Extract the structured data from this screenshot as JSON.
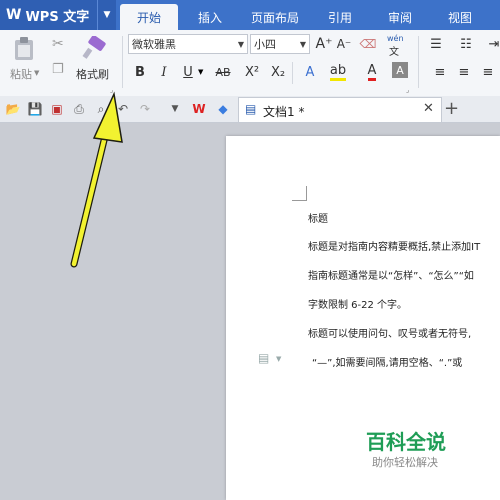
{
  "app": {
    "name": "WPS 文字"
  },
  "menu_tabs": [
    {
      "label": "开始",
      "active": true
    },
    {
      "label": "插入"
    },
    {
      "label": "页面布局"
    },
    {
      "label": "引用"
    },
    {
      "label": "审阅"
    },
    {
      "label": "视图"
    }
  ],
  "ribbon": {
    "paste_label": "粘贴",
    "format_painter_label": "格式刷",
    "font_name": "微软雅黑",
    "font_size": "小四",
    "pinyin_label": "wén"
  },
  "document": {
    "tab_title": "文档1 *",
    "lines": [
      "标题",
      "标题是对指南内容精要概括,禁止添加IT",
      "指南标题通常是以“怎样”、“怎么”“如",
      "字数限制 6-22 个字。",
      "标题可以使用问句、叹号或者无符号,",
      "“—”,如需要间隔,请用空格、“.”或"
    ]
  },
  "watermark": {
    "title": "百科全说",
    "subtitle": "助你轻松解决"
  },
  "colors": {
    "menubar": "#3d72c9",
    "annotation_arrow": "#f2f230",
    "watermark": "#1f9d56"
  }
}
